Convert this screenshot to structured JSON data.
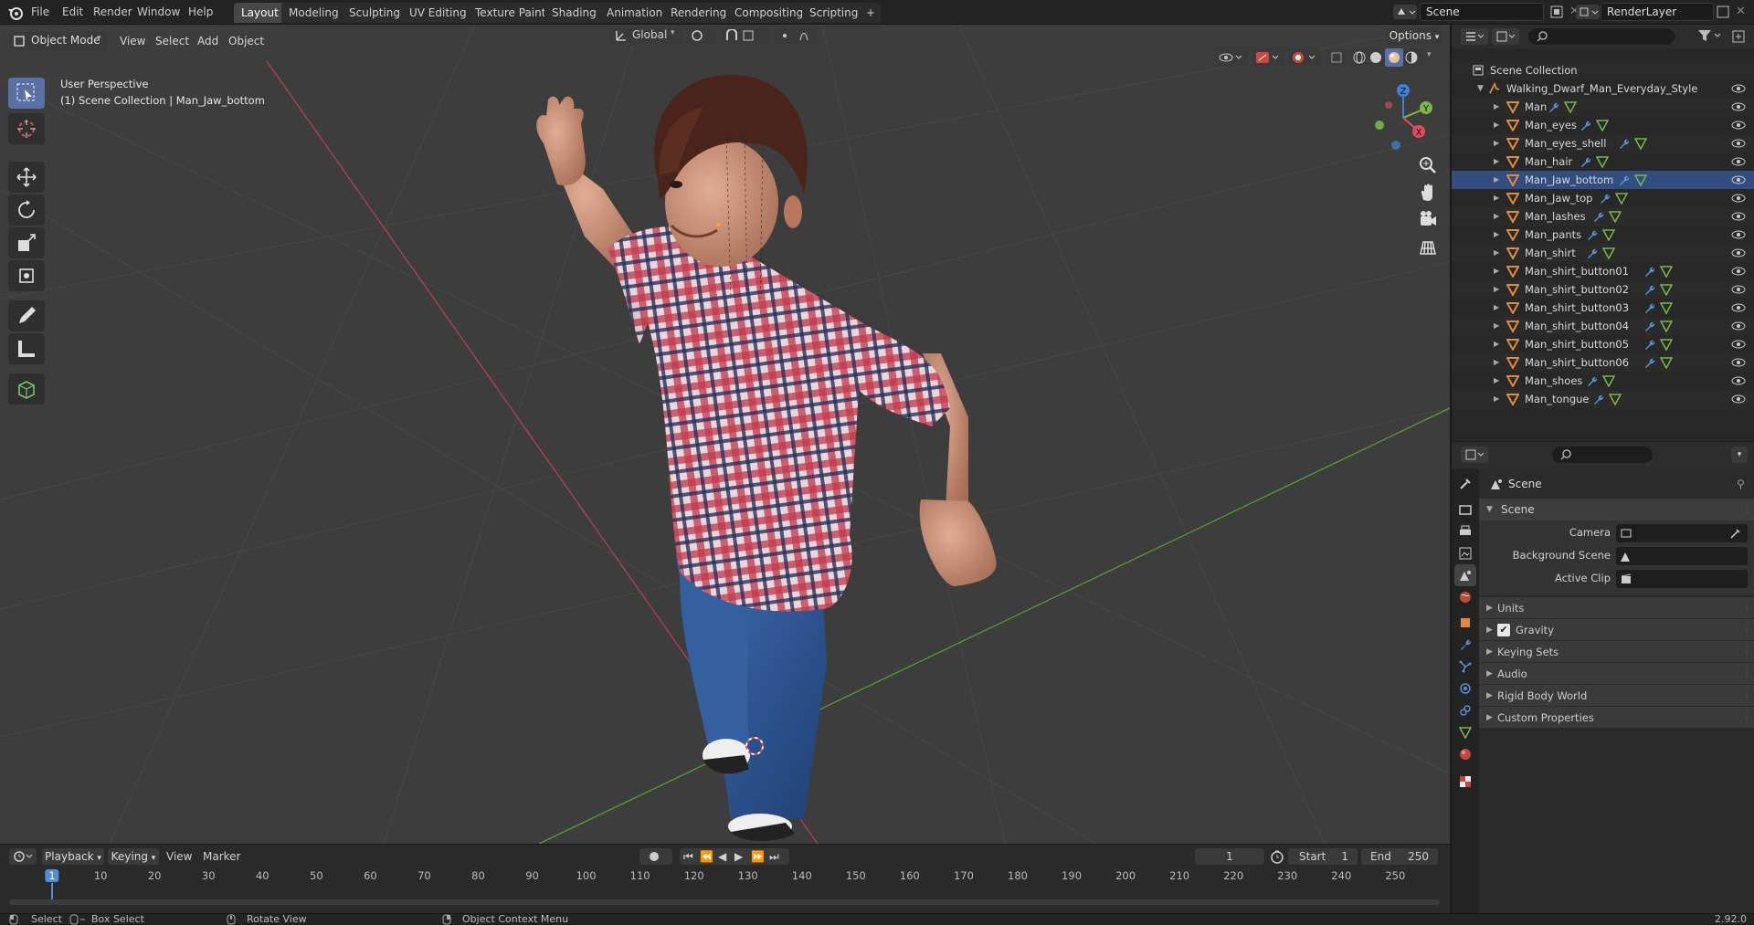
{
  "menu": [
    "File",
    "Edit",
    "Render",
    "Window",
    "Help"
  ],
  "workspaces": [
    "Layout",
    "Modeling",
    "Sculpting",
    "UV Editing",
    "Texture Paint",
    "Shading",
    "Animation",
    "Rendering",
    "Compositing",
    "Scripting"
  ],
  "active_workspace": "Layout",
  "top_right": {
    "scene": "Scene",
    "view_layer": "RenderLayer"
  },
  "viewport": {
    "mode": "Object Mode",
    "menus": [
      "View",
      "Select",
      "Add",
      "Object"
    ],
    "orientation": "Global",
    "options_label": "Options",
    "overlay_title": "User Perspective",
    "overlay_sub": "(1) Scene Collection | Man_Jaw_bottom",
    "gizmo_axes": [
      "Z",
      "Y",
      "X"
    ]
  },
  "outliner": {
    "root": "Scene Collection",
    "collection": "Walking_Dwarf_Man_Everyday_Style",
    "items": [
      "Man",
      "Man_eyes",
      "Man_eyes_shell",
      "Man_hair",
      "Man_Jaw_bottom",
      "Man_Jaw_top",
      "Man_lashes",
      "Man_pants",
      "Man_shirt",
      "Man_shirt_button01",
      "Man_shirt_button02",
      "Man_shirt_button03",
      "Man_shirt_button04",
      "Man_shirt_button05",
      "Man_shirt_button06",
      "Man_shoes",
      "Man_tongue"
    ],
    "active_item": "Man_Jaw_bottom"
  },
  "properties": {
    "header": "Scene",
    "panel": "Scene",
    "camera_label": "Camera",
    "background_label": "Background Scene",
    "clip_label": "Active Clip",
    "subpanels": [
      "Units",
      "Gravity",
      "Keying Sets",
      "Audio",
      "Rigid Body World",
      "Custom Properties"
    ],
    "gravity_checked": true
  },
  "timeline": {
    "menus": [
      "Playback",
      "Keying",
      "View",
      "Marker"
    ],
    "current_frame": "1",
    "start_label": "Start",
    "start": "1",
    "end_label": "End",
    "end": "250",
    "ticks": [
      "1",
      "10",
      "20",
      "30",
      "40",
      "50",
      "60",
      "70",
      "80",
      "90",
      "100",
      "110",
      "120",
      "130",
      "140",
      "150",
      "160",
      "170",
      "180",
      "190",
      "200",
      "210",
      "220",
      "230",
      "240",
      "250"
    ]
  },
  "status": {
    "select": "Select",
    "box_select": "Box Select",
    "rotate": "Rotate View",
    "context": "Object Context Menu",
    "version": "2.92.0"
  },
  "colors": {
    "accent": "#5b71a6",
    "selected_row": "#334d80",
    "mesh_icon": "#e08a3c",
    "axis_x": "#e04b5b",
    "axis_y": "#78b845",
    "axis_z": "#3d82d8"
  }
}
